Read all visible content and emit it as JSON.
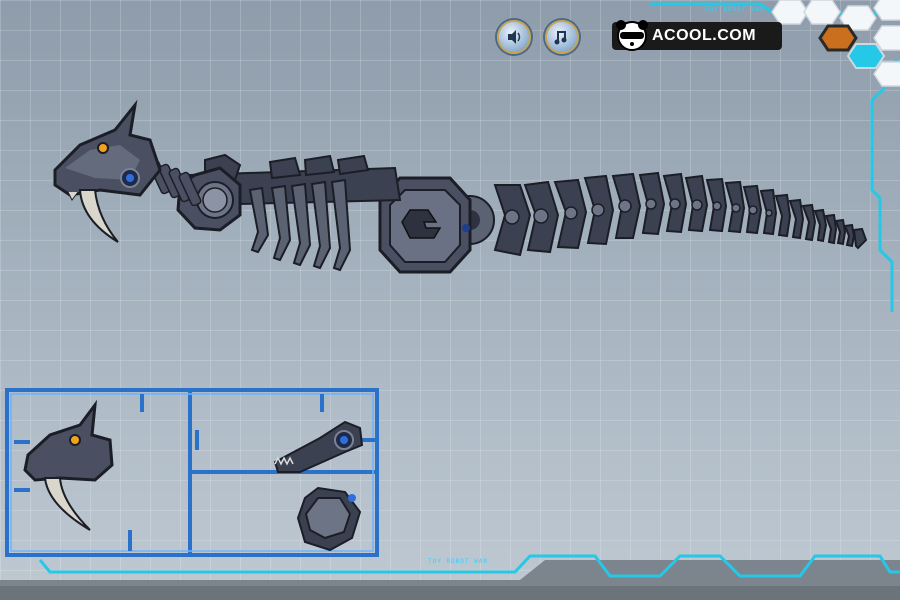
{
  "header": {
    "logo_text": "ACOOL.COM",
    "logo_icon": "panda-icon",
    "sound_icon": "speaker-icon",
    "music_icon": "music-note-icon"
  },
  "frame": {
    "top_label": "TOY ROBOT WAR",
    "bottom_label": "TOY ROBOT WAR",
    "side_label": "TOY ROBOT WAR"
  },
  "tray": {
    "parts": [
      {
        "name": "skull-head-part"
      },
      {
        "name": "jaw-bone-part"
      },
      {
        "name": "gear-joint-part"
      }
    ]
  },
  "colors": {
    "accent_cyan": "#25c8e6",
    "tray_blue": "#2a72c9",
    "hex_orange": "#c96f1d",
    "robot_dark": "#3b4150"
  }
}
